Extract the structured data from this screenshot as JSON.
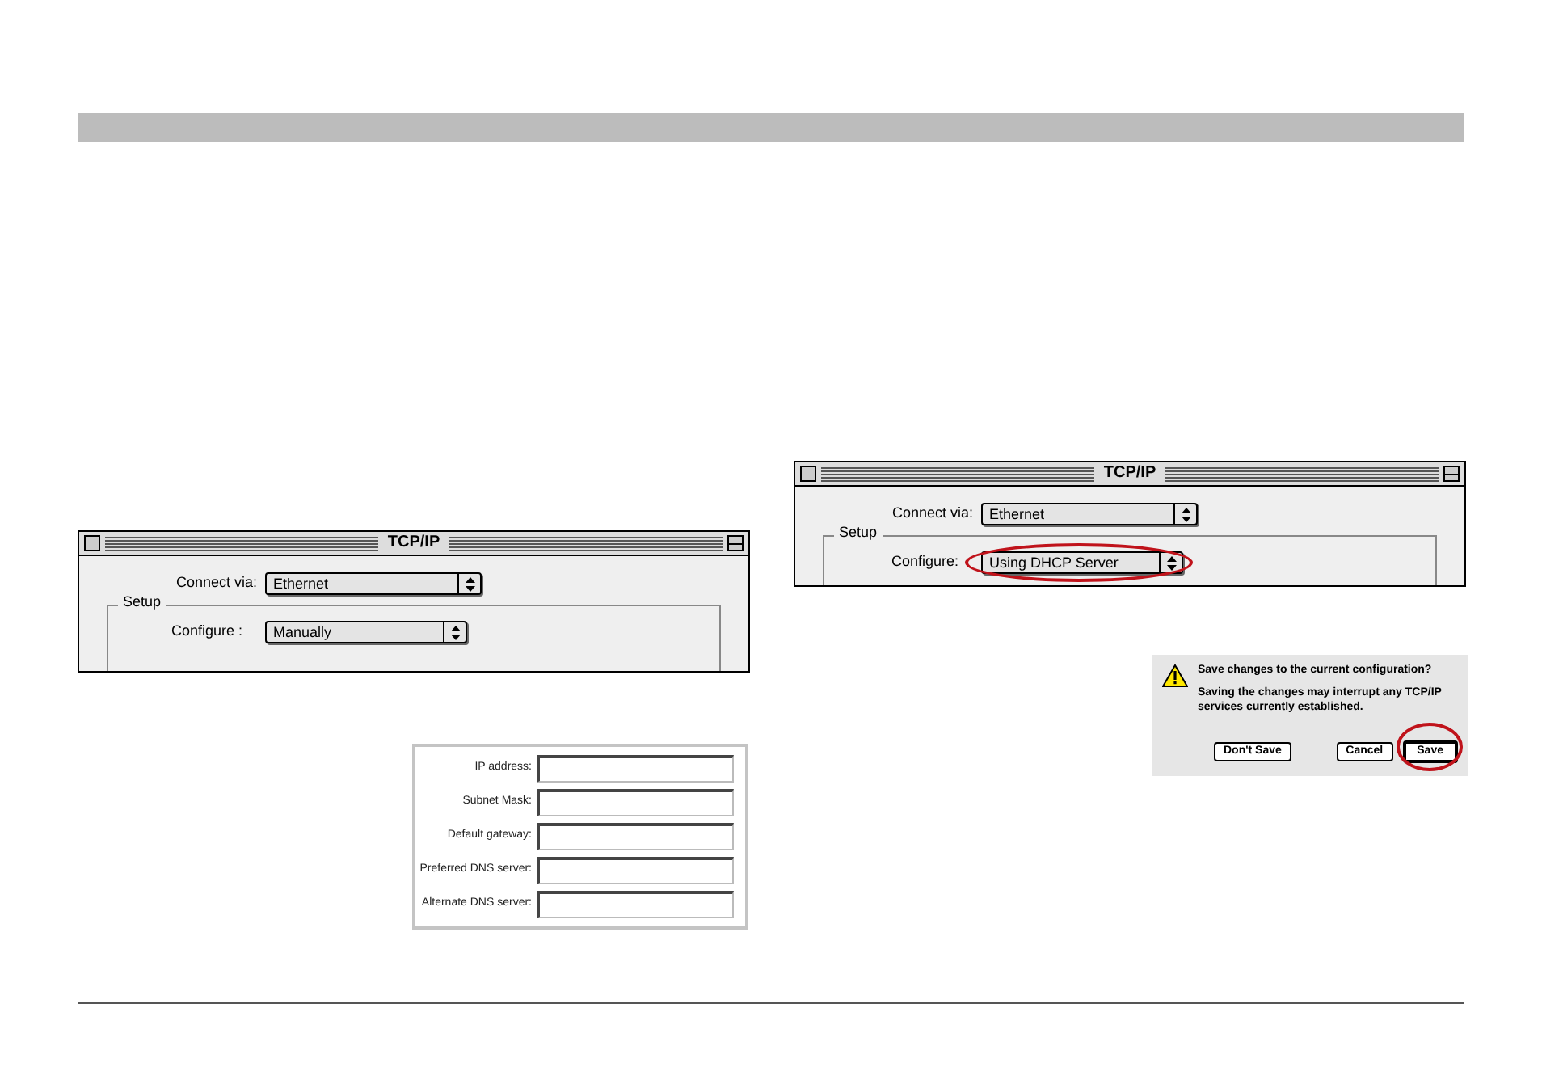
{
  "windows": [
    {
      "title": "TCP/IP",
      "connect_via": {
        "label": "Connect via:",
        "value": "Ethernet"
      },
      "group": "Setup",
      "configure": {
        "label": "Configure :",
        "value": "Manually",
        "highlighted": false
      }
    },
    {
      "title": "TCP/IP",
      "connect_via": {
        "label": "Connect via:",
        "value": "Ethernet"
      },
      "group": "Setup",
      "configure": {
        "label": "Configure:",
        "value": "Using DHCP Server",
        "highlighted": true
      }
    }
  ],
  "ip_form": {
    "fields": [
      {
        "label": "IP address:"
      },
      {
        "label": "Subnet Mask:"
      },
      {
        "label": "Default gateway:"
      },
      {
        "label": "Preferred DNS server:"
      },
      {
        "label": "Alternate DNS server:"
      }
    ]
  },
  "dialog": {
    "title": "Save changes to the current configuration?",
    "message": "Saving the changes may interrupt any TCP/IP services currently established.",
    "buttons": [
      {
        "label": "Don't Save",
        "default": false,
        "highlighted": false
      },
      {
        "label": "Cancel",
        "default": false,
        "highlighted": false
      },
      {
        "label": "Save",
        "default": true,
        "highlighted": true
      }
    ]
  }
}
